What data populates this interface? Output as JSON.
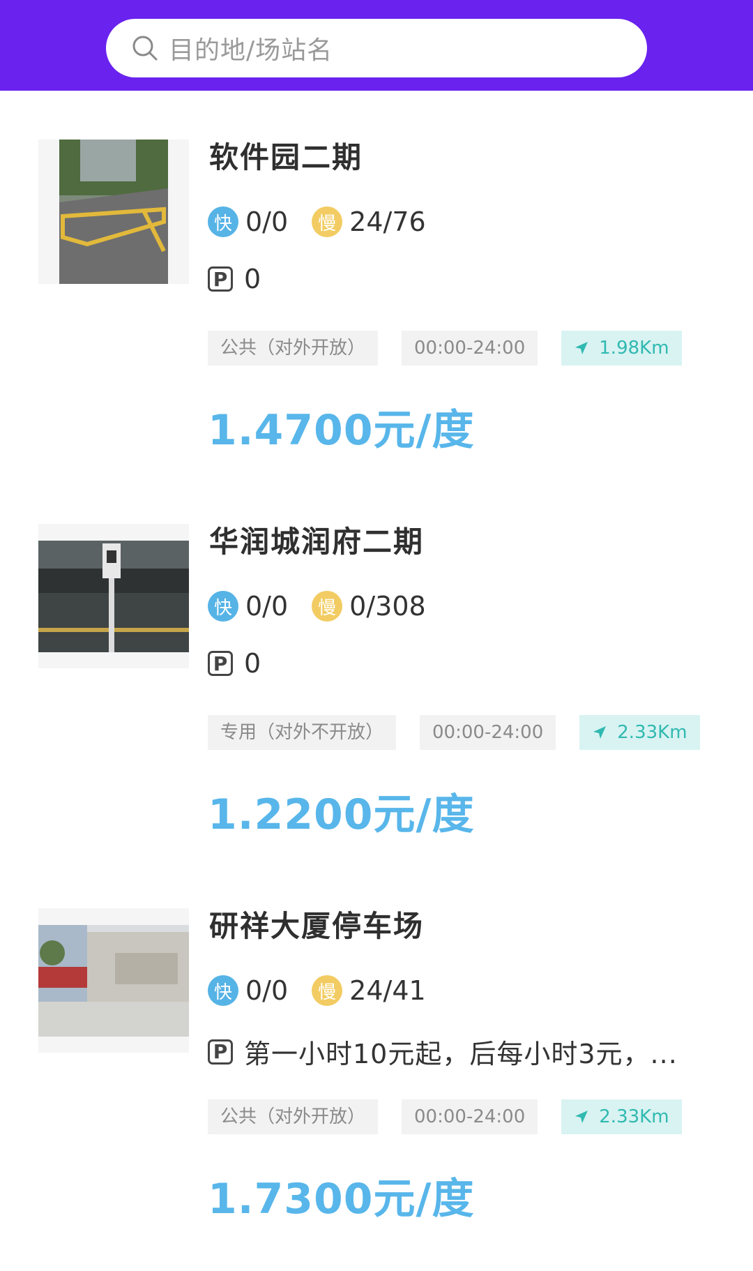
{
  "search": {
    "placeholder": "目的地/场站名"
  },
  "stations": [
    {
      "name": "软件园二期",
      "fast_label": "快",
      "fast": "0/0",
      "slow_label": "慢",
      "slow": "24/76",
      "parking": "0",
      "type": "公共（对外开放）",
      "hours": "00:00-24:00",
      "distance": "1.98Km",
      "price": "1.4700元/度"
    },
    {
      "name": "华润城润府二期",
      "fast_label": "快",
      "fast": "0/0",
      "slow_label": "慢",
      "slow": "0/308",
      "parking": "0",
      "type": "专用（对外不开放）",
      "hours": "00:00-24:00",
      "distance": "2.33Km",
      "price": "1.2200元/度"
    },
    {
      "name": "研祥大厦停车场",
      "fast_label": "快",
      "fast": "0/0",
      "slow_label": "慢",
      "slow": "24/41",
      "parking": "第一小时10元起，后每小时3元，...",
      "type": "公共（对外开放）",
      "hours": "00:00-24:00",
      "distance": "2.33Km",
      "price": "1.7300元/度"
    }
  ],
  "colors": {
    "header": "#6a22ee",
    "fast_badge": "#56b3e6",
    "slow_badge": "#f2cc63",
    "price": "#58b6ea",
    "distance": "#30b9b0"
  }
}
